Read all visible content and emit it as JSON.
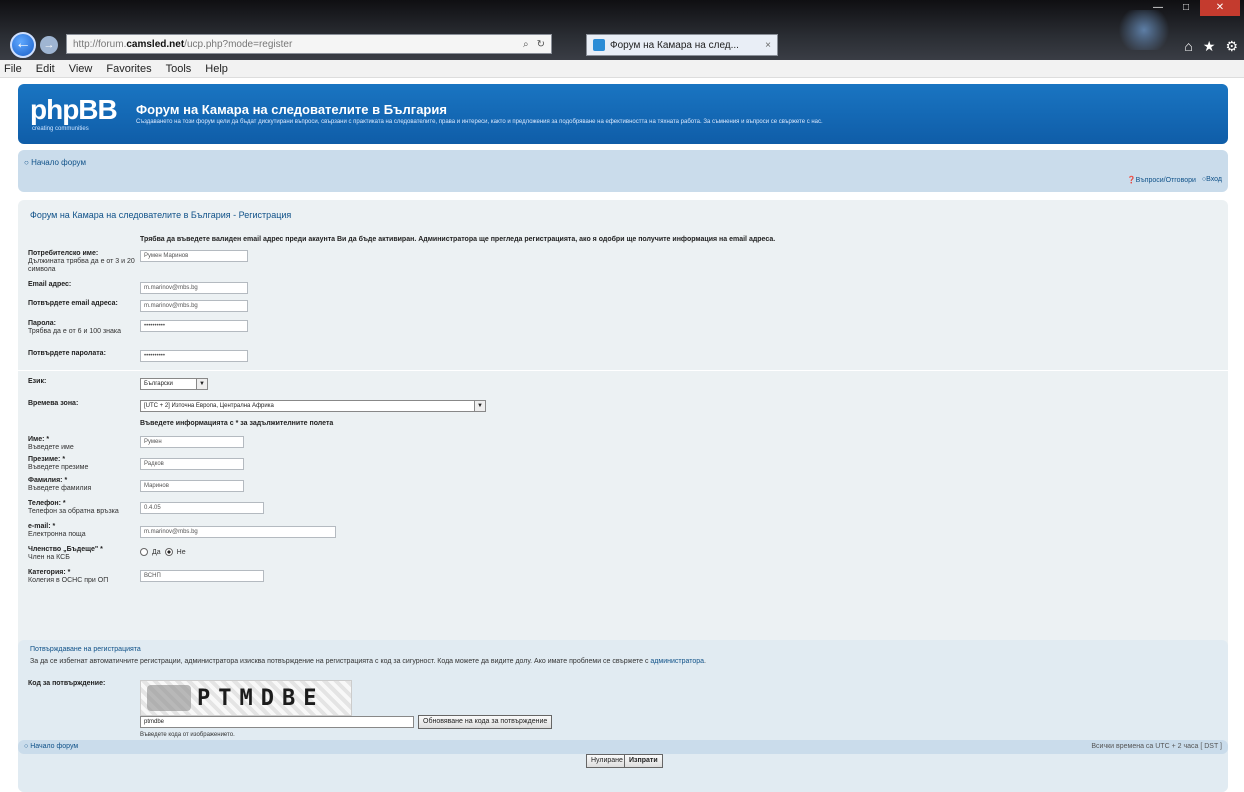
{
  "browser": {
    "url_prefix": "http://forum.",
    "url_domain": "camsled.net",
    "url_path": "/ucp.php?mode=register",
    "tab_title": "Форум на Камара на след...",
    "menu": [
      "File",
      "Edit",
      "View",
      "Favorites",
      "Tools",
      "Help"
    ]
  },
  "header": {
    "logo": "phpBB",
    "logo_tag": "creating communities",
    "title": "Форум на Камара на следователите в България",
    "description": "Създаването на този форум цели да бъдат дискутирани въпроси, свързани с практиката на следователите, права и интереси, както и предложения за подобряване на ефективността на тяхната работа. За съмнения и въпроси се свържете с нас."
  },
  "nav": {
    "home": "Начало форум",
    "faq": "Въпроси/Отговори",
    "login": "Вход"
  },
  "form": {
    "page_title": "Форум на Камара на следователите в България - Регистрация",
    "intro_note": "Трябва да въведете валиден email адрес преди акаунта Ви да бъде активиран. Администратора ще прегледа регистрацията, ако я одобри ще получите информация на email адреса.",
    "username_label": "Потребителско име:",
    "username_hint": "Дължината трябва да е от 3 и 20 символа",
    "username_value": "Румен Маринов",
    "email_label": "Email адрес:",
    "email_value": "m.marinov@mbs.bg",
    "email_confirm_label": "Потвърдете email адреса:",
    "email_confirm_value": "m.marinov@mbs.bg",
    "password_label": "Парола:",
    "password_hint": "Трябва да е от 6 и 100 знака",
    "password_value": "••••••••••",
    "password_confirm_label": "Потвърдете паролата:",
    "password_confirm_value": "••••••••••",
    "lang_label": "Език:",
    "lang_value": "Български",
    "tz_label": "Времева зона:",
    "tz_value": "[UTC + 2] Източна Европа, Централна Африка",
    "required_note": "Въведете информацията с * за задължителните полета",
    "name_label": "Име: *",
    "name_hint": "Въведете име",
    "name_value": "Румен",
    "mid_label": "Презиме: *",
    "mid_hint": "Въведете презиме",
    "mid_value": "Радков",
    "last_label": "Фамилия: *",
    "last_hint": "Въведете фамилия",
    "last_value": "Маринов",
    "phone_label": "Телефон: *",
    "phone_hint": "Телефон за обратна връзка",
    "phone_value": "0.4.05",
    "mail2_label": "e-mail: *",
    "mail2_hint": "Електронна поща",
    "mail2_value": "m.marinov@mbs.bg",
    "member_label": "Членство „Бъдеще\" *",
    "member_hint": "Член на КСБ",
    "radio_yes": "Да",
    "radio_no": "Не",
    "region_label": "Категория: *",
    "region_hint": "Колегия в ОСНС при ОП",
    "region_value": "ВСНП"
  },
  "confirm": {
    "title": "Потвърждаване на регистрацията",
    "description": "За да се избегнат автоматичните регистрации, администратора изисква потвърждение на регистрацията с код за сигурност. Кода можете да видите долу. Ако имате проблеми се свържете с",
    "admin_link": "администратора",
    "code_label": "Код за потвърждение:",
    "captcha_text": "PTMDBE",
    "code_value": "ptmdbe",
    "new_code_btn": "Обновяване на кода за потвърждение",
    "code_hint": "Въведете кода от изображението."
  },
  "buttons": {
    "reset": "Нулиране",
    "submit": "Изпрати"
  },
  "footer": {
    "home": "Начало форум",
    "right": "Всички времена са UTC + 2 часа [ DST ]"
  }
}
